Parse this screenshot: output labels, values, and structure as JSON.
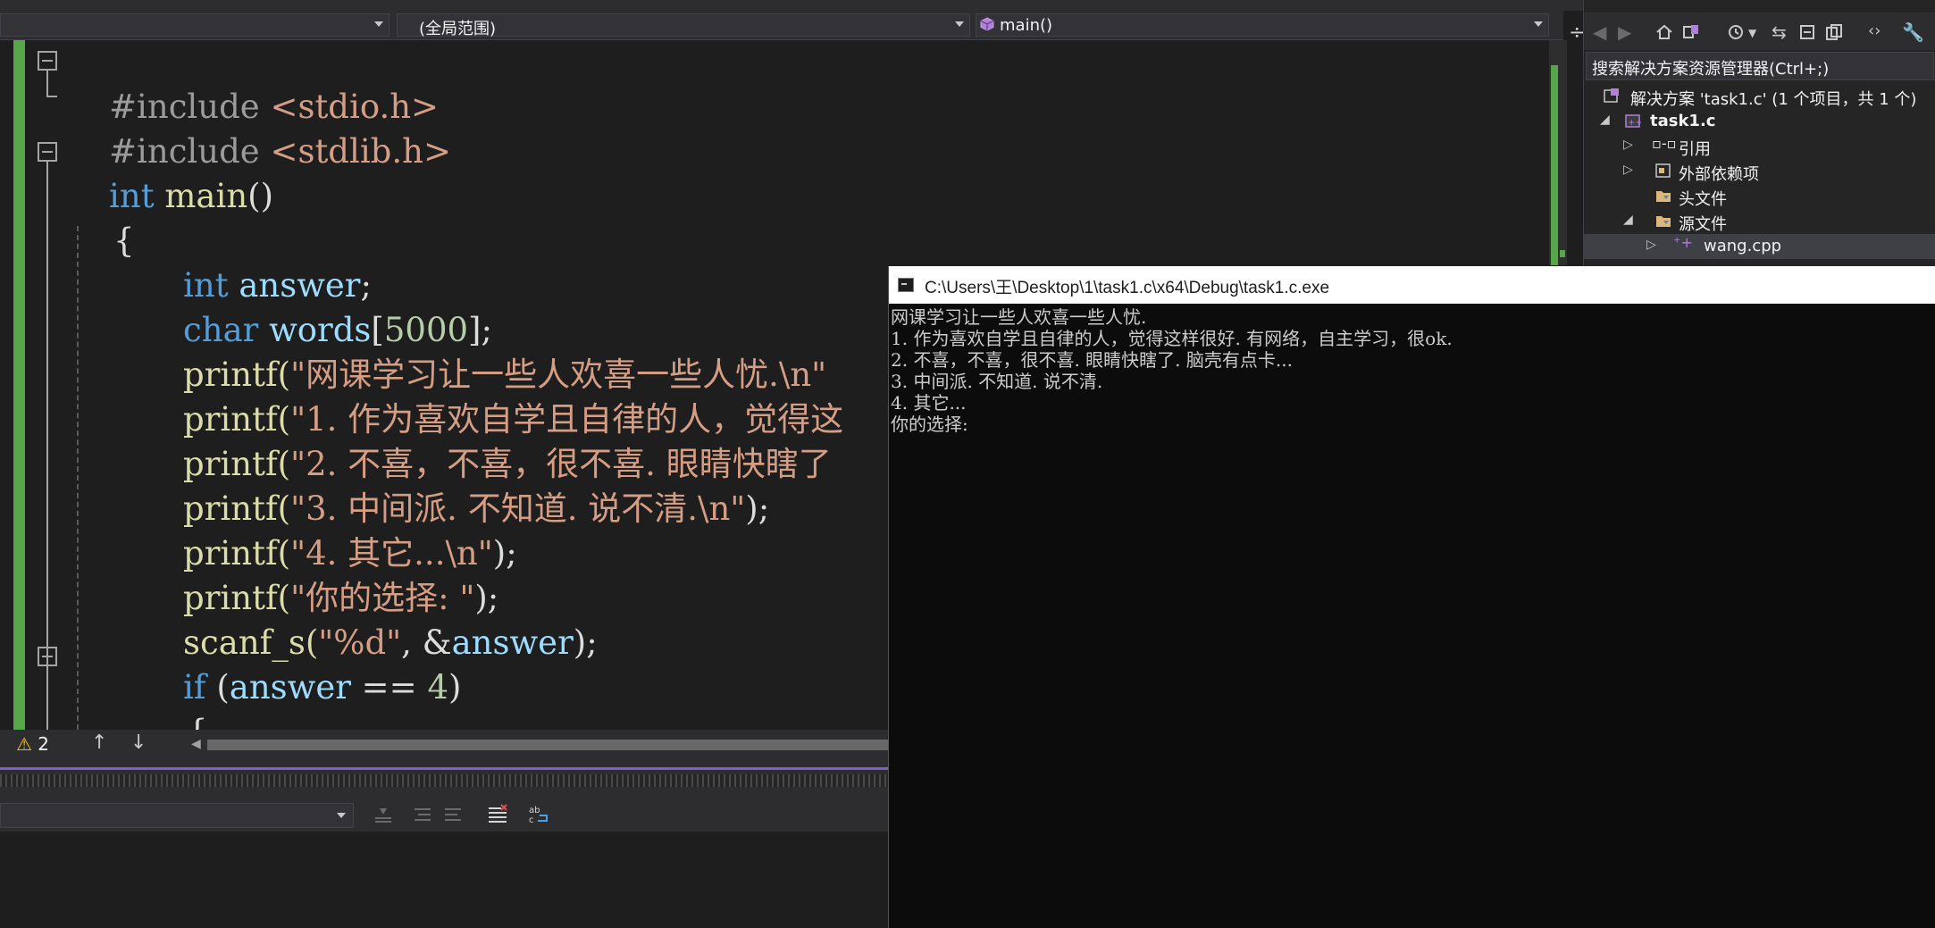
{
  "nav": {
    "scope_label": "(全局范围)",
    "function_label": "main()"
  },
  "editor": {
    "lines": [
      "#include <stdio.h>",
      "#include <stdlib.h>",
      "int main()",
      "{",
      "int answer;",
      "char words[5000];",
      "printf(\"网课学习让一些人欢喜一些人忧.\\n\"",
      "printf(\"1. 作为喜欢自学且自律的人，觉得这",
      "printf(\"2. 不喜，不喜，很不喜. 眼睛快瞎了",
      "printf(\"3. 中间派. 不知道. 说不清.\\n\");",
      "printf(\"4. 其它...\\n\");",
      "printf(\"你的选择: \");",
      "scanf_s(\"%d\", &answer);",
      "if (answer == 4)",
      "{"
    ]
  },
  "status": {
    "warning_count": "2"
  },
  "console": {
    "title": "C:\\Users\\王\\Desktop\\1\\task1.c\\x64\\Debug\\task1.c.exe",
    "lines": [
      "网课学习让一些人欢喜一些人忧.",
      "1. 作为喜欢自学且自律的人，觉得这样很好. 有网络，自主学习，很ok.",
      "2. 不喜，不喜，很不喜. 眼睛快瞎了. 脑壳有点卡...",
      "3. 中间派. 不知道. 说不清.",
      "4. 其它...",
      "你的选择:"
    ]
  },
  "solution_explorer": {
    "search_placeholder": "搜索解决方案资源管理器(Ctrl+;)",
    "tree": [
      {
        "label": "解决方案 'task1.c' (1 个项目，共 1 个)",
        "bold": false
      },
      {
        "label": "task1.c",
        "bold": true
      },
      {
        "label": "引用",
        "bold": false
      },
      {
        "label": "外部依赖项",
        "bold": false
      },
      {
        "label": "头文件",
        "bold": false
      },
      {
        "label": "源文件",
        "bold": false
      },
      {
        "label": "wang.cpp",
        "bold": false
      }
    ]
  },
  "colors": {
    "editor_bg": "#1e1e1e",
    "keyword": "#569cd6",
    "string": "#d69d85",
    "function": "#dcdcaa",
    "change_bar": "#57a64a",
    "console_bg": "#0c0c0c",
    "output_accent": "#7f5fd0"
  }
}
